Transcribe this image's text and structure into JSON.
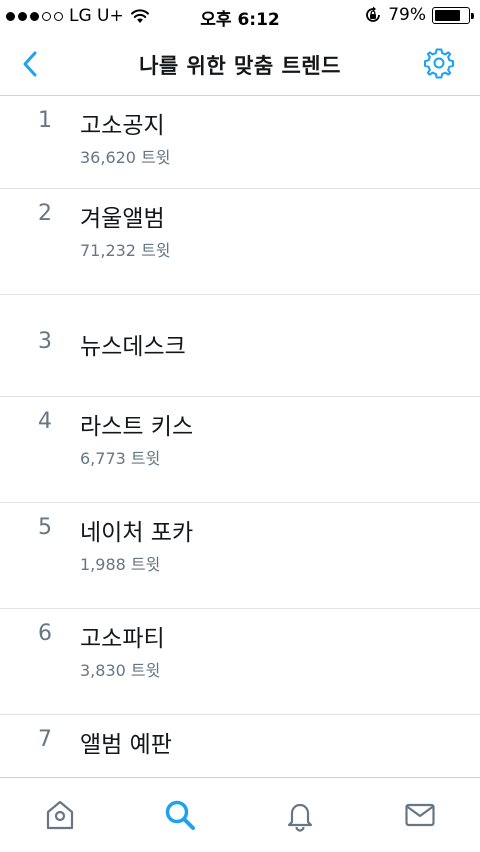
{
  "status_bar": {
    "carrier": "LG U+",
    "time": "오후 6:12",
    "battery_text": "79%",
    "battery_level": 0.79
  },
  "nav": {
    "title": "나를 위한 맞춤 트렌드",
    "accent_color": "#1da1f2"
  },
  "trends": [
    {
      "rank": "1",
      "name": "고소공지",
      "count": "36,620 트윗"
    },
    {
      "rank": "2",
      "name": "겨울앨범",
      "count": "71,232 트윗"
    },
    {
      "rank": "3",
      "name": "뉴스데스크"
    },
    {
      "rank": "4",
      "name": "라스트 키스",
      "count": "6,773 트윗"
    },
    {
      "rank": "5",
      "name": "네이처 포카",
      "count": "1,988 트윗"
    },
    {
      "rank": "6",
      "name": "고소파티",
      "count": "3,830 트윗"
    },
    {
      "rank": "7",
      "name": "앨범 예판"
    }
  ],
  "tab_bar": {
    "tabs": [
      {
        "icon": "home-icon",
        "active": false
      },
      {
        "icon": "search-icon",
        "active": true
      },
      {
        "icon": "bell-icon",
        "active": false
      },
      {
        "icon": "mail-icon",
        "active": false
      }
    ]
  }
}
